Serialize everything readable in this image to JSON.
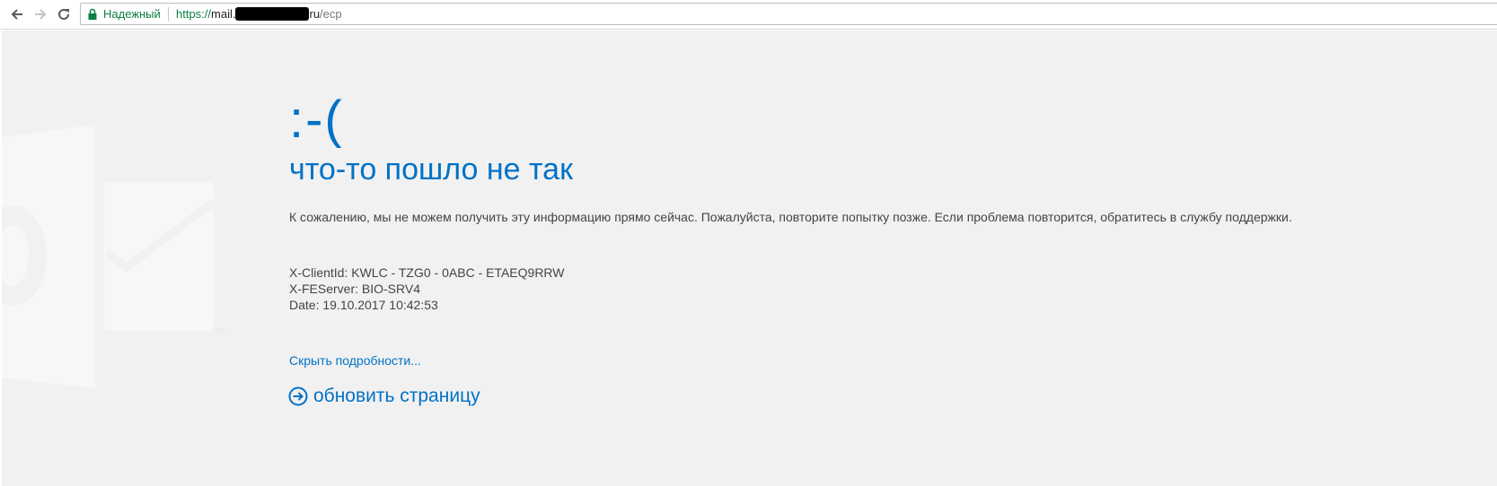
{
  "browser": {
    "secure_label": "Надежный",
    "url": {
      "scheme": "https://",
      "host_visible": "mail.",
      "host_tail": "ru",
      "path": "/ecp"
    },
    "icons": {
      "back": "arrow-left-icon",
      "forward": "arrow-right-icon",
      "reload": "reload-icon",
      "lock": "lock-icon"
    },
    "colors": {
      "secure_green": "#0b8043"
    }
  },
  "error_page": {
    "face": ":-(",
    "headline": "что-то пошло не так",
    "message": "К сожалению, мы не можем получить эту информацию прямо сейчас. Пожалуйста, повторите попытку позже. Если проблема повторится, обратитесь в службу поддержки.",
    "details": {
      "client_id": "X-ClientId: KWLC - TZG0 - 0ABC - ETAEQ9RRW",
      "fe_server": "X-FEServer: BIO-SRV4",
      "date": "Date: 19.10.2017 10:42:53"
    },
    "hide_details_link": "Скрыть подробности...",
    "refresh_link": "обновить страницу",
    "icons": {
      "background_logo": "outlook-logo-icon",
      "refresh": "arrow-circle-right-icon"
    },
    "colors": {
      "accent": "#0072c6",
      "background": "#f1f1f1",
      "text": "#444444"
    }
  }
}
